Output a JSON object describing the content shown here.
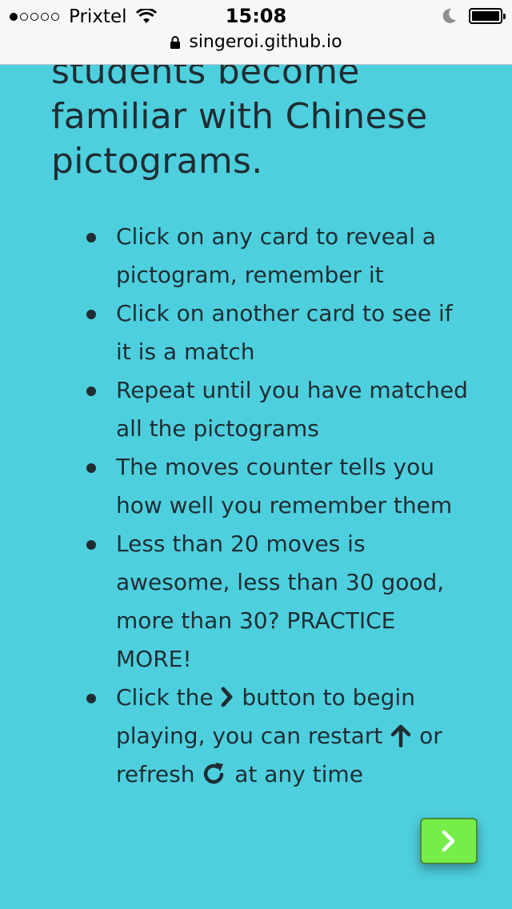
{
  "status_bar": {
    "carrier": "Prixtel",
    "time": "15:08",
    "signal_bars_filled": 1,
    "signal_bars_total": 5,
    "battery_level": 1.0
  },
  "url_bar": {
    "url": "singeroi.github.io"
  },
  "main": {
    "heading_lines": [
      "students become",
      "familiar with Chinese",
      "pictograms."
    ],
    "rules": [
      {
        "text": "Click on any card to reveal a pictogram, remember it"
      },
      {
        "text": "Click on another card to see if it is a match"
      },
      {
        "text": "Repeat until you have matched all the pictograms"
      },
      {
        "text": "The moves counter tells you how well you remember them"
      },
      {
        "text": "Less than 20 moves is awesome, less than 30 good, more than 30? PRACTICE MORE!"
      },
      {
        "part1": "Click the",
        "part2": "button to begin playing, you can restart",
        "part3": "or refresh",
        "part4": "at any time"
      }
    ]
  },
  "icons": {
    "next": "chevron-right-icon",
    "restart": "arrow-up-icon",
    "refresh": "refresh-icon"
  },
  "colors": {
    "background": "#4ecfde",
    "text": "#1f2d33",
    "next_button": "#76ee4a"
  }
}
